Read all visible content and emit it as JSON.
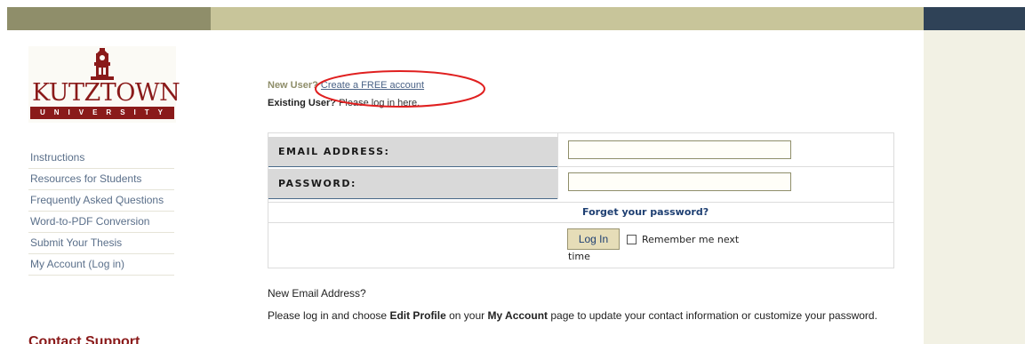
{
  "logo": {
    "word": "KUTZTOWN",
    "subword": "UNIVERSITY"
  },
  "nav": {
    "items": [
      {
        "label": "Instructions"
      },
      {
        "label": "Resources for Students"
      },
      {
        "label": "Frequently Asked Questions"
      },
      {
        "label": "Word-to-PDF Conversion"
      },
      {
        "label": "Submit Your Thesis"
      },
      {
        "label": "My Account (Log in)"
      }
    ],
    "contact_heading": "Contact Support"
  },
  "intro": {
    "new_user_label": "New User?",
    "create_link": "Create a FREE account",
    "existing_user_label": "Existing User?",
    "existing_user_text": "Please log in here."
  },
  "form": {
    "email_label": "EMAIL ADDRESS:",
    "email_value": "",
    "password_label": "PASSWORD:",
    "password_value": "",
    "forget_link": "Forget your password?",
    "login_button": "Log In",
    "remember_label_part1": "Remember me next",
    "remember_label_part2": "time"
  },
  "new_email": {
    "heading": "New Email Address?",
    "text_1": "Please log in and choose ",
    "text_bold_1": "Edit Profile",
    "text_2": " on your ",
    "text_bold_2": "My Account",
    "text_3": " page to update your contact information or customize your password."
  },
  "colors": {
    "banner_left": "#8f8e6a",
    "banner_mid": "#c8c59a",
    "banner_right": "#2f4257",
    "brand_red": "#8a1a1a",
    "annotation_red": "#e02020"
  }
}
